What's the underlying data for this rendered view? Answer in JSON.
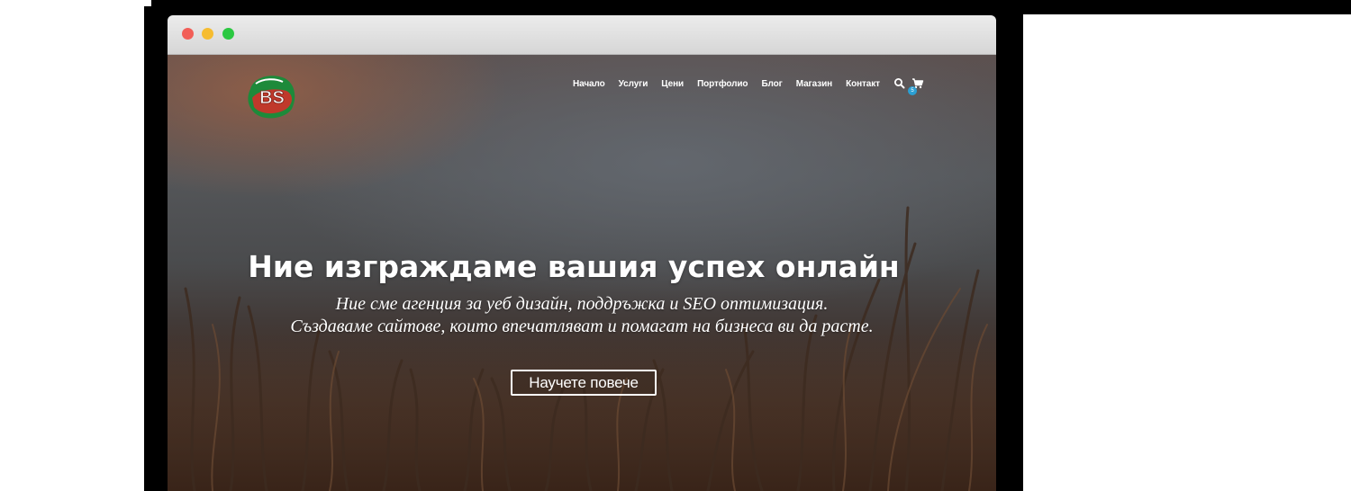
{
  "site": {
    "logo_text": "BS",
    "nav": {
      "items": [
        {
          "label": "Начало"
        },
        {
          "label": "Услуги"
        },
        {
          "label": "Цени"
        },
        {
          "label": "Портфолио"
        },
        {
          "label": "Блог"
        },
        {
          "label": "Магазин"
        },
        {
          "label": "Контакт"
        }
      ],
      "search_icon": "search-icon",
      "cart_icon": "cart-icon",
      "cart_count": "5"
    },
    "hero": {
      "headline": "Ние изграждаме вашия успех онлайн",
      "subline_1": "Ние сме агенция за уеб дизайн, поддръжка и SEO оптимизация.",
      "subline_2": "Създаваме сайтове, които впечатляват и помагат на бизнеса ви да расте.",
      "cta_label": "Научете повече"
    }
  },
  "colors": {
    "accent": "#2b9fd3",
    "window_close": "#f25e57",
    "window_minimize": "#f6bc30",
    "window_maximize": "#2bc841"
  }
}
